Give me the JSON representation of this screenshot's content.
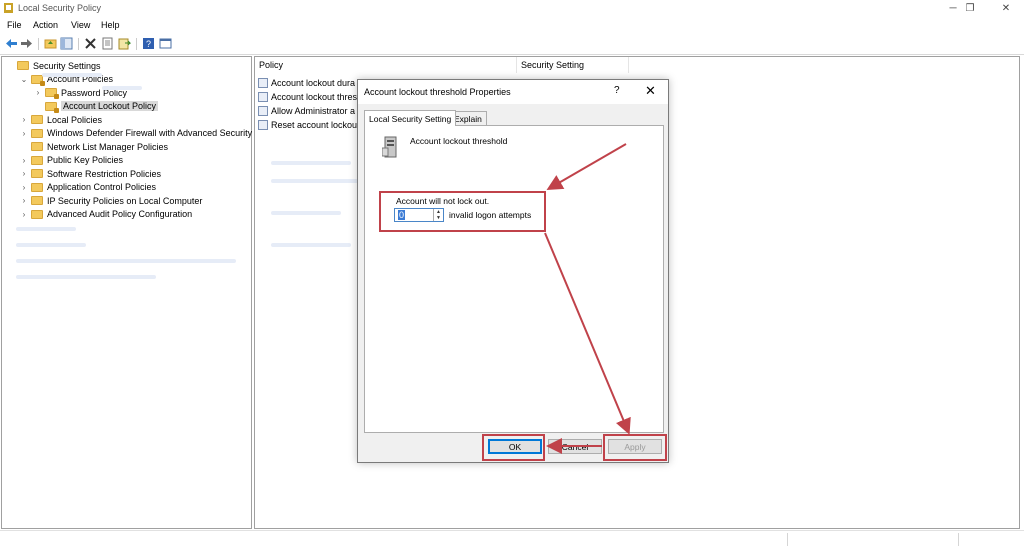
{
  "window": {
    "title": "Local Security Policy",
    "minimize_glyph": "─",
    "restore_glyph": "❐",
    "close_glyph": "✕"
  },
  "menu": [
    "File",
    "Action",
    "View",
    "Help"
  ],
  "toolbar_icons": [
    "back-icon",
    "forward-icon",
    "up-folder-icon",
    "show-hide-tree-icon",
    "delete-icon",
    "properties-icon",
    "export-list-icon",
    "help-icon",
    "view-icon"
  ],
  "tree": [
    {
      "label": "Security Settings",
      "expander": "",
      "indent": 0
    },
    {
      "label": "Account Policies",
      "expander": "⌄",
      "indent": 1
    },
    {
      "label": "Password Policy",
      "expander": "›",
      "indent": 2
    },
    {
      "label": "Account Lockout Policy",
      "expander": "",
      "indent": 2,
      "selected": true
    },
    {
      "label": "Local Policies",
      "expander": "›",
      "indent": 1
    },
    {
      "label": "Windows Defender Firewall with Advanced Security",
      "expander": "›",
      "indent": 1
    },
    {
      "label": "Network List Manager Policies",
      "expander": "",
      "indent": 1
    },
    {
      "label": "Public Key Policies",
      "expander": "›",
      "indent": 1
    },
    {
      "label": "Software Restriction Policies",
      "expander": "›",
      "indent": 1
    },
    {
      "label": "Application Control Policies",
      "expander": "›",
      "indent": 1
    },
    {
      "label": "IP Security Policies on Local Computer",
      "expander": "›",
      "indent": 1
    },
    {
      "label": "Advanced Audit Policy Configuration",
      "expander": "›",
      "indent": 1
    }
  ],
  "list": {
    "headers": [
      "Policy",
      "Security Setting"
    ],
    "rows": [
      "Account lockout dura",
      "Account lockout thres",
      "Allow Administrator a",
      "Reset account lockout"
    ]
  },
  "dialog": {
    "title": "Account lockout threshold Properties",
    "help": "?",
    "close": "✕",
    "tabs": [
      "Local Security Setting",
      "Explain"
    ],
    "setting_name": "Account lockout threshold",
    "lock_label": "Account will not lock out.",
    "threshold_value": "0",
    "suffix": "invalid logon attempts",
    "buttons": {
      "ok": "OK",
      "cancel": "Cancel",
      "apply": "Apply"
    }
  },
  "colors": {
    "annotation": "#c0424a",
    "ok_focus": "#0078d7"
  }
}
